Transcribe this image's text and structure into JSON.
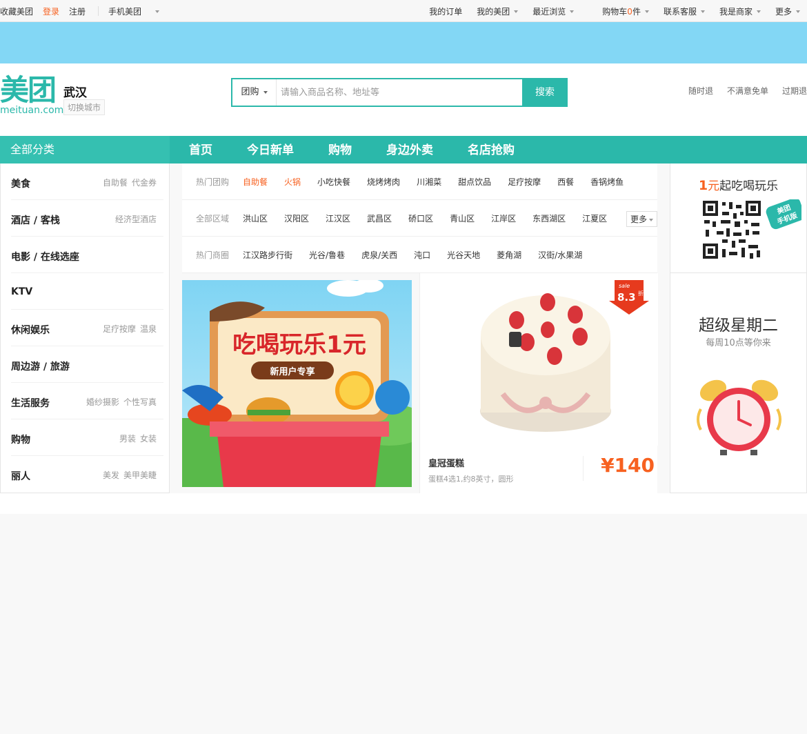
{
  "topbar": {
    "left": [
      "收藏美团",
      "登录",
      "注册"
    ],
    "mobile": "手机美团",
    "right": {
      "orders": "我的订单",
      "my_meituan": "我的美团",
      "recent": "最近浏览",
      "cart_prefix": "购物车",
      "cart_count": "0",
      "cart_suffix": "件",
      "service": "联系客服",
      "merchant": "我是商家",
      "more": "更多"
    }
  },
  "header": {
    "logo_cn": "美团",
    "logo_en": "meituan.com",
    "city": "武汉",
    "switch_city": "切换城市",
    "search": {
      "category": "团购",
      "placeholder": "请输入商品名称、地址等",
      "button": "搜索"
    },
    "promises": [
      "随时退",
      "不满意免单",
      "过期退"
    ]
  },
  "nav": {
    "all_categories": "全部分类",
    "items": [
      "首页",
      "今日新单",
      "购物",
      "身边外卖",
      "名店抢购"
    ]
  },
  "sidebar": {
    "categories": [
      {
        "name": "美食",
        "subs": [
          "自助餐",
          "代金券"
        ]
      },
      {
        "name": "酒店 / 客栈",
        "subs": [
          "经济型酒店"
        ]
      },
      {
        "name": "电影 / 在线选座",
        "subs": []
      },
      {
        "name": "KTV",
        "subs": []
      },
      {
        "name": "休闲娱乐",
        "subs": [
          "足疗按摩",
          "温泉"
        ]
      },
      {
        "name": "周边游 / 旅游",
        "subs": []
      },
      {
        "name": "生活服务",
        "subs": [
          "婚纱摄影",
          "个性写真"
        ]
      },
      {
        "name": "购物",
        "subs": [
          "男装",
          "女装"
        ]
      },
      {
        "name": "丽人",
        "subs": [
          "美发",
          "美甲美睫"
        ]
      }
    ]
  },
  "filters": {
    "hot_deals": {
      "label": "热门团购",
      "items": [
        "自助餐",
        "火锅",
        "小吃快餐",
        "烧烤烤肉",
        "川湘菜",
        "甜点饮品",
        "足疗按摩",
        "西餐",
        "香锅烤鱼"
      ]
    },
    "areas": {
      "label": "全部区域",
      "items": [
        "洪山区",
        "汉阳区",
        "江汉区",
        "武昌区",
        "硚口区",
        "青山区",
        "江岸区",
        "东西湖区",
        "江夏区"
      ],
      "more": "更多"
    },
    "districts": {
      "label": "热门商圈",
      "items": [
        "江汉路步行街",
        "光谷/鲁巷",
        "虎泉/关西",
        "沌口",
        "光谷天地",
        "菱角湖",
        "汉街/水果湖"
      ]
    }
  },
  "promo_banner": {
    "title": "吃喝玩乐1元",
    "subtitle": "新用户专享"
  },
  "deal": {
    "title": "皇冠蛋糕",
    "desc": "蛋糕4选1,约8英寸，圆形",
    "price": "¥140",
    "discount": "8.3",
    "discount_unit": "折",
    "sale": "sale"
  },
  "right": {
    "promo_one": "1",
    "promo_unit": "元",
    "promo_rest": "起吃喝玩乐",
    "qr_tag_1": "美团",
    "qr_tag_2": "手机版",
    "super_title": "超级星期二",
    "super_sub": "每周10点等你来"
  },
  "colors": {
    "brand": "#2bb8aa",
    "accent": "#f76120",
    "banner": "#83d7f5"
  }
}
